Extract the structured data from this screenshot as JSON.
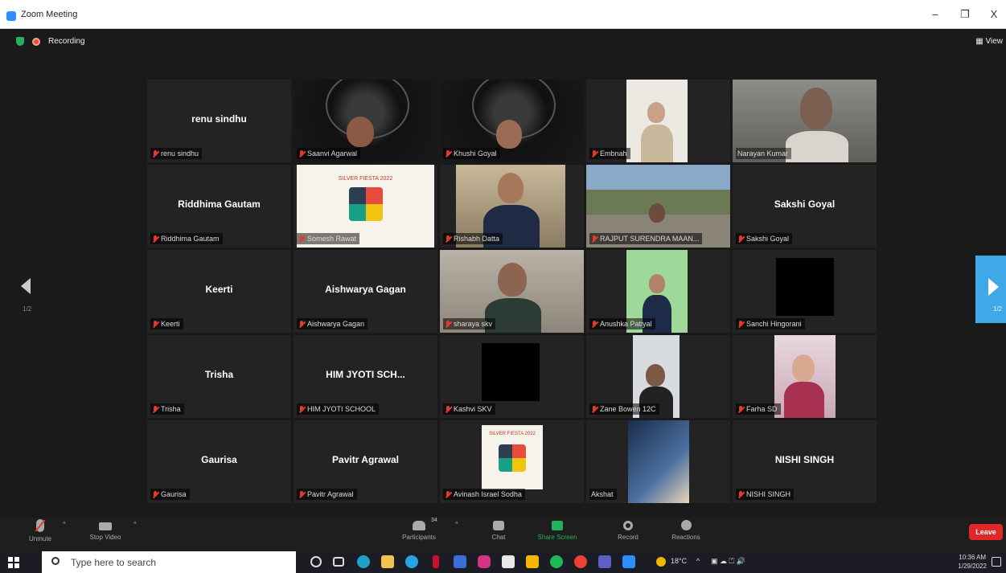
{
  "window": {
    "title": "Zoom Meeting",
    "minimize": "–",
    "restore": "❐",
    "close": "X"
  },
  "topbar": {
    "recording_label": "Recording",
    "view_label": "View"
  },
  "pager": {
    "left_page": "1/2",
    "right_page": "1/2"
  },
  "tiles": [
    {
      "center": "renu sindhu",
      "label": "renu sindhu",
      "muted": true
    },
    {
      "center": "",
      "label": "Saanvi Agarwal",
      "muted": true
    },
    {
      "center": "",
      "label": "Khushi Goyal",
      "muted": true
    },
    {
      "center": "",
      "label": "Embnah",
      "muted": true
    },
    {
      "center": "",
      "label": "Narayan Kumar",
      "muted": false
    },
    {
      "center": "Riddhima Gautam",
      "label": "Riddhima Gautam",
      "muted": true
    },
    {
      "center": "",
      "label": "Somesh Rawat",
      "muted": true
    },
    {
      "center": "",
      "label": "Rishabh Datta",
      "muted": true
    },
    {
      "center": "",
      "label": "RAJPUT SURENDRA MAAN...",
      "muted": true
    },
    {
      "center": "Sakshi Goyal",
      "label": "Sakshi Goyal",
      "muted": true
    },
    {
      "center": "Keerti",
      "label": "Keerti",
      "muted": true
    },
    {
      "center": "Aishwarya Gagan",
      "label": "Aishwarya Gagan",
      "muted": true
    },
    {
      "center": "",
      "label": "sharaya skv",
      "muted": true
    },
    {
      "center": "",
      "label": "Anushka Patiyal",
      "muted": true
    },
    {
      "center": "",
      "label": "Sanchi Hingorani",
      "muted": true
    },
    {
      "center": "Trisha",
      "label": "Trisha",
      "muted": true
    },
    {
      "center": "HIM JYOTI SCH...",
      "label": "HIM JYOTI SCHOOL",
      "muted": true
    },
    {
      "center": "",
      "label": "Kashvi SKV",
      "muted": true
    },
    {
      "center": "",
      "label": "Zane Bowen 12C",
      "muted": true
    },
    {
      "center": "",
      "label": "Farha SD",
      "muted": true
    },
    {
      "center": "Gaurisa",
      "label": "Gaurisa",
      "muted": true
    },
    {
      "center": "Pavitr Agrawal",
      "label": "Pavitr Agrawal",
      "muted": true
    },
    {
      "center": "",
      "label": "Avinash Israel Sodha",
      "muted": true
    },
    {
      "center": "",
      "label": "Akshat",
      "muted": false
    },
    {
      "center": "NISHI SINGH",
      "label": "NISHI SINGH",
      "muted": true
    }
  ],
  "poster_title": "SILVER FIESTA 2022",
  "controls": {
    "unmute": "Unmute",
    "stop_video": "Stop Video",
    "participants": "Participants",
    "participants_count": "34",
    "chat": "Chat",
    "share_screen": "Share Screen",
    "record": "Record",
    "reactions": "Reactions",
    "leave": "Leave"
  },
  "taskbar": {
    "search_placeholder": "Type here to search",
    "weather": "18°C",
    "time": "10:36 AM",
    "date": "1/29/2022"
  },
  "colors": {
    "accent": "#2d8cff",
    "active_speaker": "#c8d94a",
    "leave": "#e02828",
    "share": "#23b15e"
  }
}
